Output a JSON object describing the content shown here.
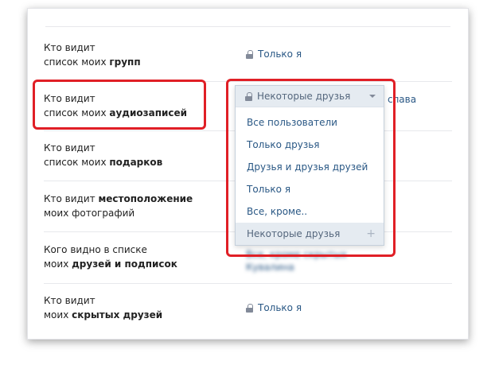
{
  "settings": {
    "rows": [
      {
        "line1": "Кто видит",
        "line2_plain": "список моих ",
        "line2_bold": "групп",
        "value": "Только я",
        "show_lock": true
      },
      {
        "line1": "Кто видит",
        "line2_plain": "список моих ",
        "line2_bold": "аудиозаписей",
        "value": "Некоторые друзья",
        "trailing": "слава"
      },
      {
        "line1": "Кто видит",
        "line2_plain": "список моих ",
        "line2_bold": "подарков"
      },
      {
        "line1_plain": "Кто видит ",
        "line1_bold": "местоположение",
        "line2": "моих фотографий"
      },
      {
        "line1": "Кого видно в списке",
        "line2_plain": "моих ",
        "line2_bold": "друзей и подписок",
        "value_blurred_1": "Все, кроме скрытых",
        "value_blurred_2": "Кувалина"
      },
      {
        "line1": "Кто видит",
        "line2_plain": "моих ",
        "line2_bold": "скрытых друзей",
        "value": "Только я",
        "show_lock": true
      }
    ]
  },
  "dropdown": {
    "selected": "Некоторые друзья",
    "options": [
      "Все пользователи",
      "Только друзья",
      "Друзья и друзья друзей",
      "Только я",
      "Все, кроме.."
    ],
    "highlighted_option": "Некоторые друзья"
  },
  "icons": {
    "lock": "lock-icon",
    "caret": "caret-down-icon",
    "plus": "plus-icon"
  },
  "colors": {
    "link": "#2a5885",
    "highlight_frame": "#e01f26",
    "muted": "#828a99"
  }
}
